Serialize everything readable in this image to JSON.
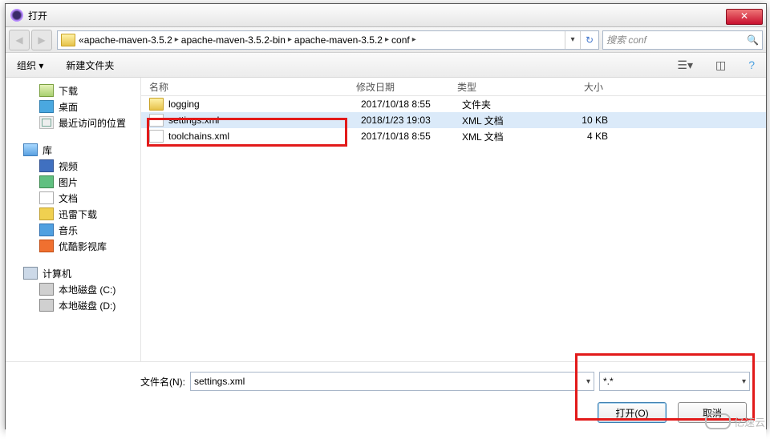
{
  "window": {
    "title": "打开"
  },
  "breadcrumbs": {
    "prefix": "«",
    "b0": "apache-maven-3.5.2",
    "b1": "apache-maven-3.5.2-bin",
    "b2": "apache-maven-3.5.2",
    "b3": "conf"
  },
  "search": {
    "placeholder": "搜索 conf"
  },
  "toolbar": {
    "organize": "组织 ▾",
    "newfolder": "新建文件夹"
  },
  "sidebar": {
    "downloads": "下载",
    "desktop": "桌面",
    "recent": "最近访问的位置",
    "libraries": "库",
    "videos": "视频",
    "pictures": "图片",
    "documents": "文档",
    "xunlei": "迅雷下载",
    "music": "音乐",
    "youku": "优酷影视库",
    "computer": "计算机",
    "diskC": "本地磁盘 (C:)",
    "diskD": "本地磁盘 (D:)"
  },
  "columns": {
    "name": "名称",
    "date": "修改日期",
    "type": "类型",
    "size": "大小"
  },
  "files": {
    "r0": {
      "name": "logging",
      "date": "2017/10/18 8:55",
      "type": "文件夹",
      "size": ""
    },
    "r1": {
      "name": "settings.xml",
      "date": "2018/1/23 19:03",
      "type": "XML 文档",
      "size": "10 KB"
    },
    "r2": {
      "name": "toolchains.xml",
      "date": "2017/10/18 8:55",
      "type": "XML 文档",
      "size": "4 KB"
    }
  },
  "footer": {
    "filename_label": "文件名(N):",
    "filename_value": "settings.xml",
    "filter": "*.*",
    "open": "打开(O)",
    "cancel": "取消"
  },
  "watermark": "亿速云"
}
